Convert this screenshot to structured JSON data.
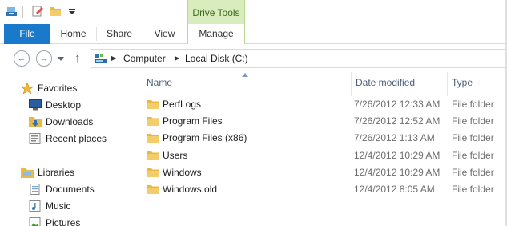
{
  "titlebar": {
    "contextual_group": "Drive Tools"
  },
  "ribbon": {
    "tabs": [
      "File",
      "Home",
      "Share",
      "View",
      "Manage"
    ]
  },
  "address": {
    "crumbs": [
      "Computer",
      "Local Disk (C:)"
    ]
  },
  "navpane": {
    "favorites_label": "Favorites",
    "favorites": [
      "Desktop",
      "Downloads",
      "Recent places"
    ],
    "libraries_label": "Libraries",
    "libraries": [
      "Documents",
      "Music",
      "Pictures"
    ]
  },
  "content": {
    "columns": {
      "name": "Name",
      "date": "Date modified",
      "type": "Type"
    },
    "rows": [
      {
        "name": "PerfLogs",
        "date": "7/26/2012 12:33 AM",
        "type": "File folder"
      },
      {
        "name": "Program Files",
        "date": "7/26/2012 12:52 AM",
        "type": "File folder"
      },
      {
        "name": "Program Files (x86)",
        "date": "7/26/2012 1:13 AM",
        "type": "File folder"
      },
      {
        "name": "Users",
        "date": "12/4/2012 10:29 AM",
        "type": "File folder"
      },
      {
        "name": "Windows",
        "date": "12/4/2012 10:29 AM",
        "type": "File folder"
      },
      {
        "name": "Windows.old",
        "date": "12/4/2012 8:05 AM",
        "type": "File folder"
      }
    ]
  },
  "colors": {
    "file_tab": "#1979ca",
    "drive_tools_band": "#d8ecbd",
    "folder": "#e8b94a"
  }
}
